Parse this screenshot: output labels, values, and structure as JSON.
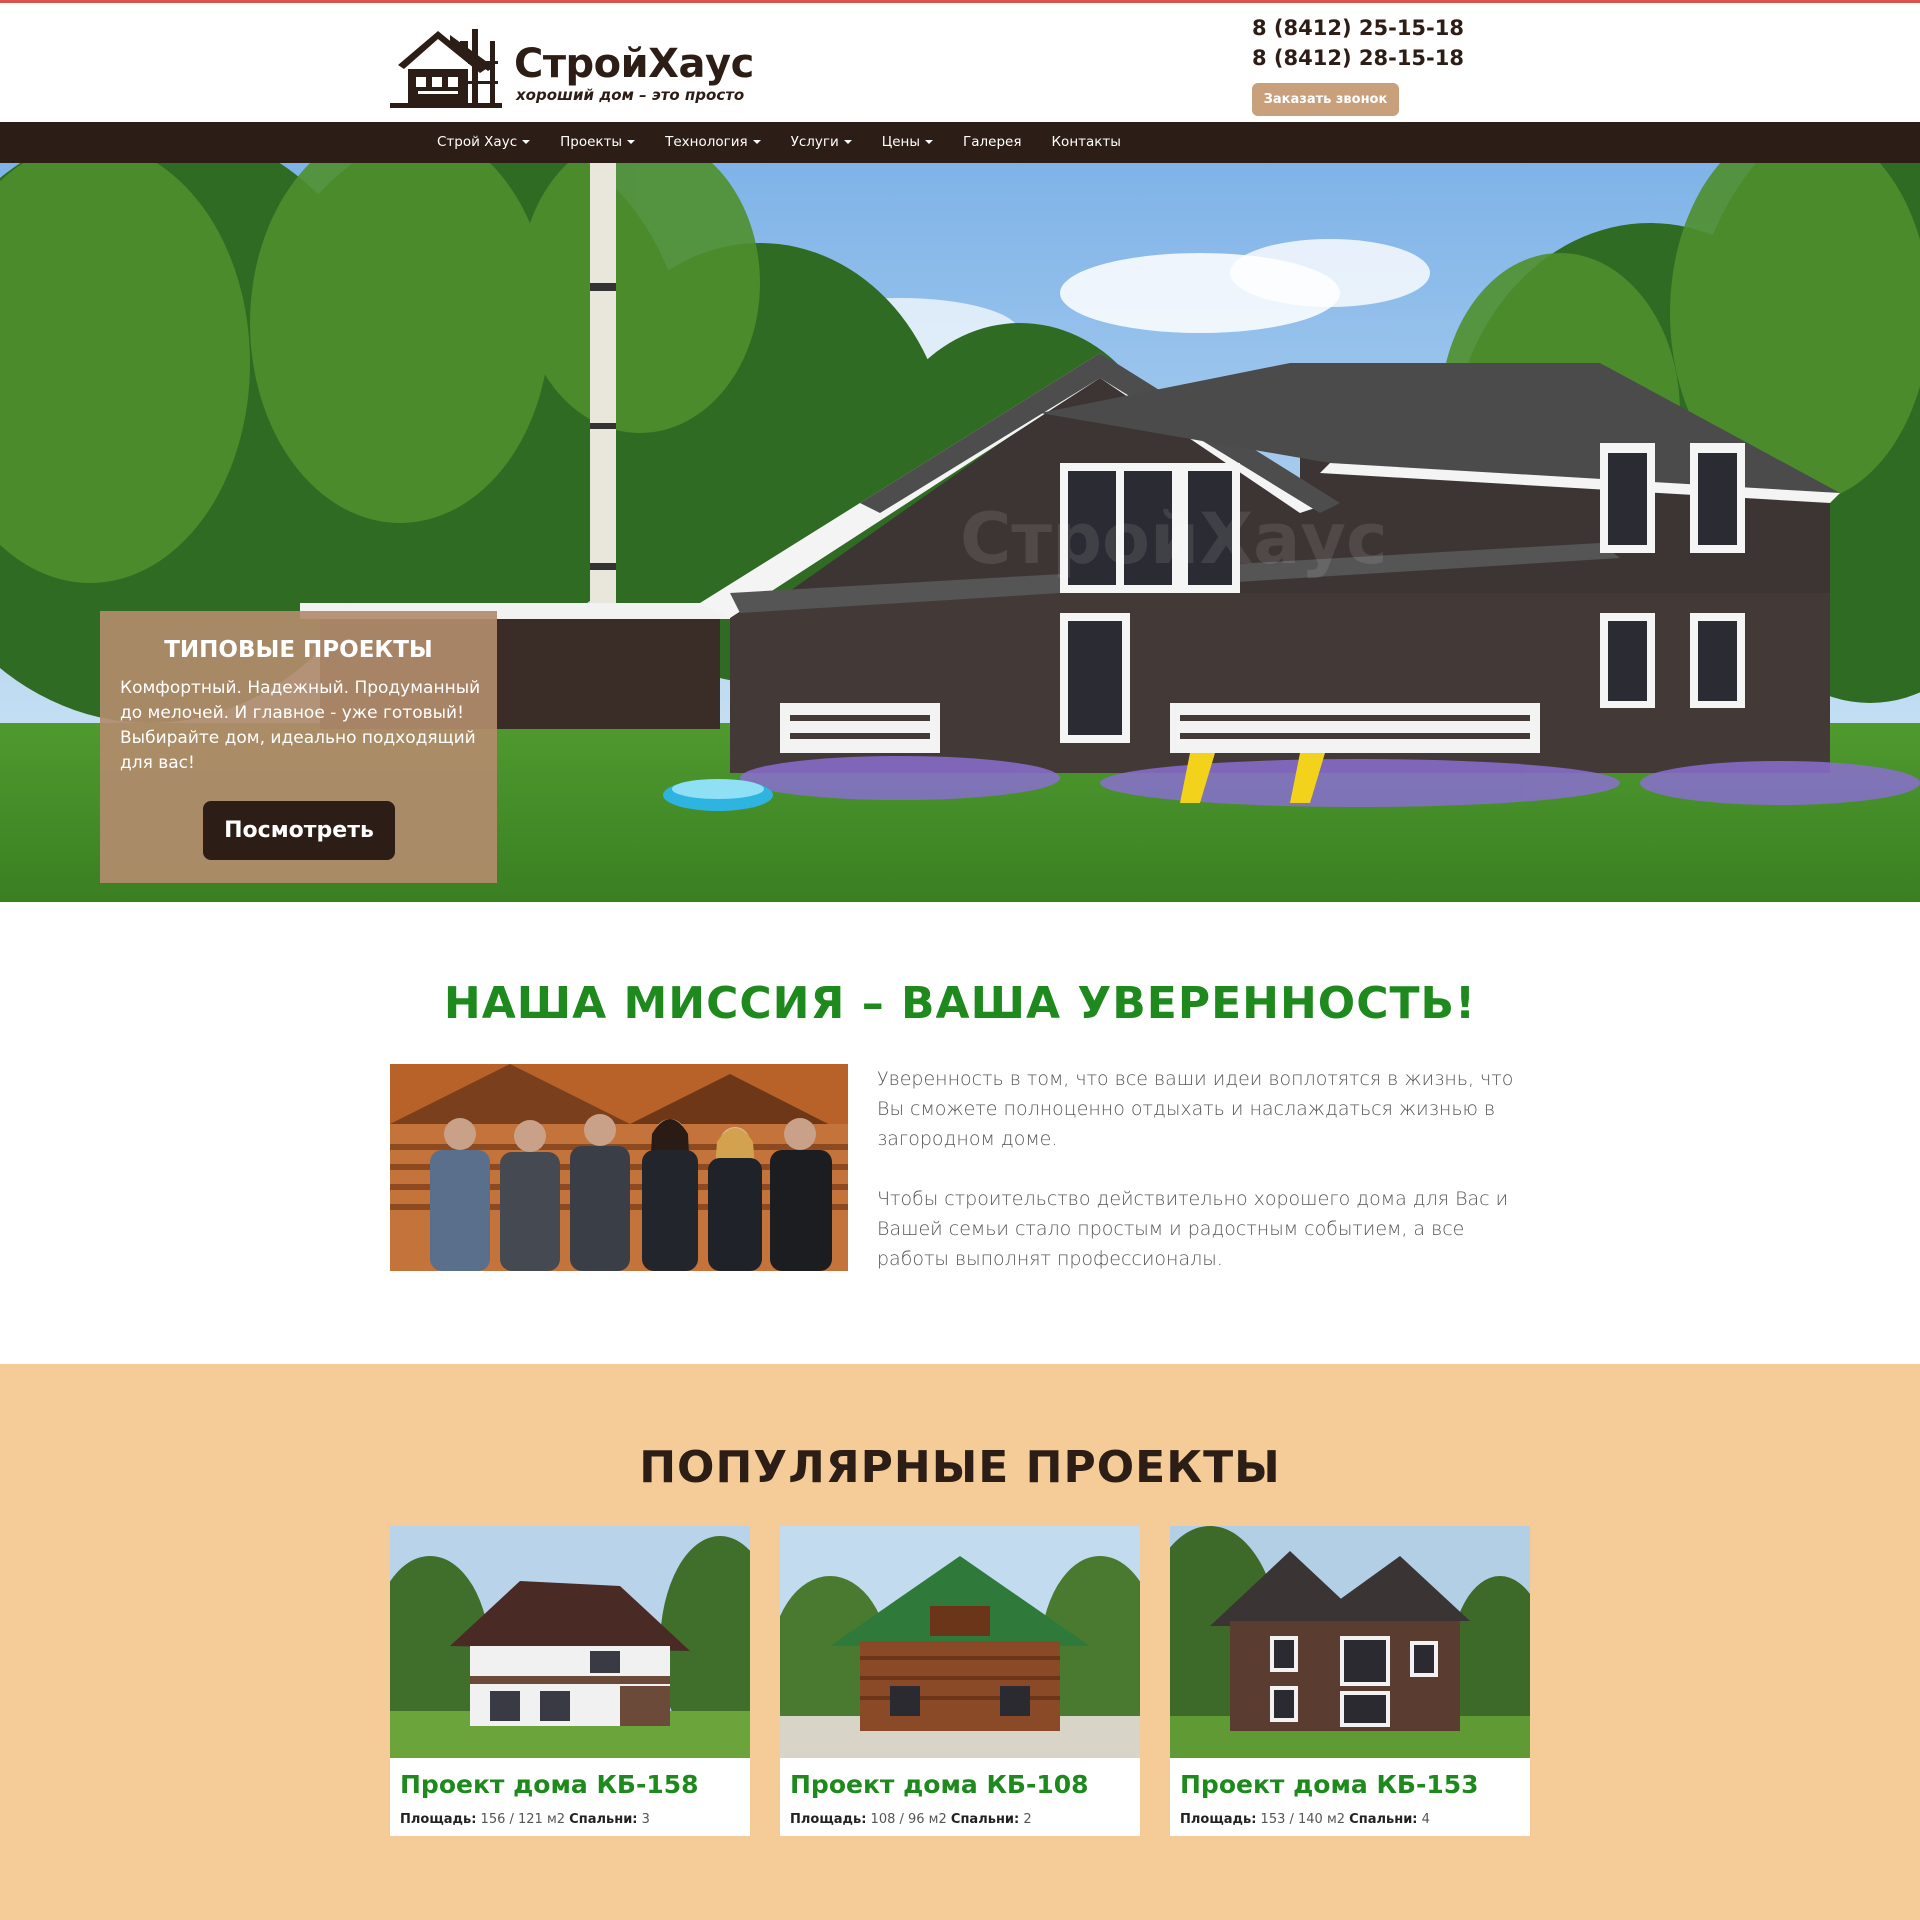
{
  "brand": {
    "title": "СтройХаус",
    "subtitle": "хороший дом – это просто"
  },
  "contacts": {
    "phones": [
      "8 (8412) 25-15-18",
      "8 (8412) 28-15-18"
    ],
    "callback_label": "Заказать звонок"
  },
  "nav": {
    "items": [
      {
        "label": "Строй Хаус",
        "dropdown": true
      },
      {
        "label": "Проекты",
        "dropdown": true
      },
      {
        "label": "Технология",
        "dropdown": true
      },
      {
        "label": "Услуги",
        "dropdown": true
      },
      {
        "label": "Цены",
        "dropdown": true
      },
      {
        "label": "Галерея",
        "dropdown": false
      },
      {
        "label": "Контакты",
        "dropdown": false
      }
    ]
  },
  "hero": {
    "card_title": "ТИПОВЫЕ ПРОЕКТЫ",
    "card_text": "Комфортный. Надежный. Продуманный до мелочей. И главное - уже готовый! Выбирайте дом, идеально подходящий для вас!",
    "button_label": "Посмотреть"
  },
  "mission": {
    "title": "НАША МИССИЯ – ВАША УВЕРЕННОСТЬ!",
    "paragraphs": [
      "Уверенность в том, что все ваши идеи воплотятся в жизнь, что Вы сможете полноценно отдыхать и наслаждаться жизнью в загородном доме.",
      "Чтобы строительство действительно хорошего дома для Вас и Вашей семьи стало простым и радостным событием, а все работы выполнят профессионалы."
    ]
  },
  "popular": {
    "title": "ПОПУЛЯРНЫЕ ПРОЕКТЫ",
    "area_label": "Площадь:",
    "bedrooms_label": "Спальни:",
    "projects": [
      {
        "title": "Проект дома КБ-158",
        "area": "156 / 121 м2",
        "bedrooms": "3",
        "roof_color": "#4a2a24"
      },
      {
        "title": "Проект дома КБ-108",
        "area": "108 / 96 м2",
        "bedrooms": "2",
        "roof_color": "#2f7a3a"
      },
      {
        "title": "Проект дома КБ-153",
        "area": "153 / 140 м2",
        "bedrooms": "4",
        "roof_color": "#3a3434"
      }
    ]
  },
  "colors": {
    "brand_dark": "#2c1e16",
    "accent_green": "#1e8a1e",
    "accent_tan": "#c9a07c",
    "section_bg": "#f5cb97"
  }
}
